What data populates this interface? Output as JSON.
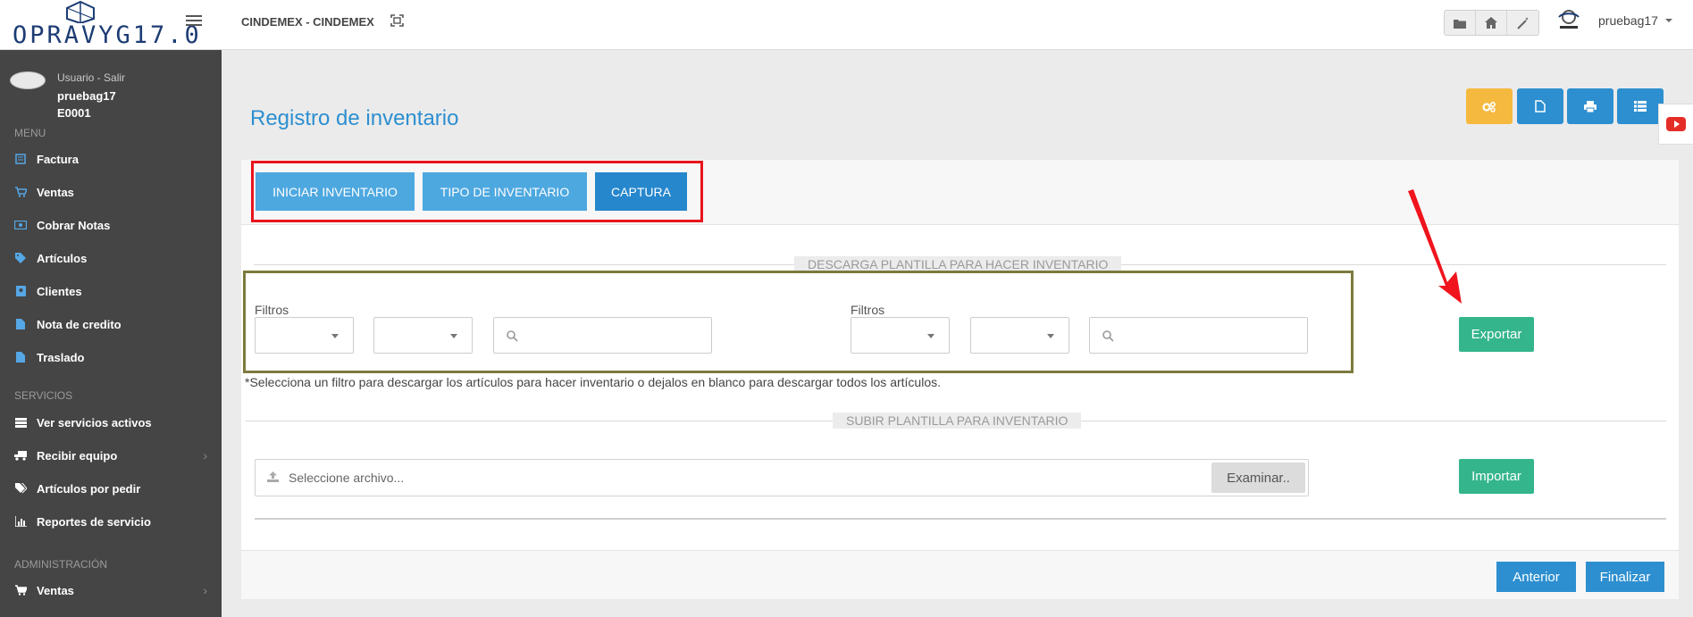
{
  "header": {
    "logo_text": "OPRAVYG17.0",
    "company": "CINDEMEX - CINDEMEX",
    "username": "pruebag17",
    "icons": [
      "folder-icon",
      "home-icon",
      "magic-wand-icon"
    ]
  },
  "sidebar": {
    "user_links": "Usuario - Salir",
    "user_name": "pruebag17",
    "user_code": "E0001",
    "sections": [
      "MENU",
      "SERVICIOS",
      "ADMINISTRACIÓN"
    ],
    "menu": [
      {
        "label": "Factura",
        "icon": "invoice-icon"
      },
      {
        "label": "Ventas",
        "icon": "cart-icon"
      },
      {
        "label": "Cobrar Notas",
        "icon": "money-icon"
      },
      {
        "label": "Artículos",
        "icon": "tag-icon"
      },
      {
        "label": "Clientes",
        "icon": "address-book-icon"
      },
      {
        "label": "Nota de credito",
        "icon": "document-icon"
      },
      {
        "label": "Traslado",
        "icon": "document-icon"
      }
    ],
    "servicios": [
      {
        "label": "Ver servicios activos",
        "icon": "server-icon"
      },
      {
        "label": "Recibir equipo",
        "icon": "truck-icon"
      },
      {
        "label": "Artículos por pedir",
        "icon": "tags-icon"
      },
      {
        "label": "Reportes de servicio",
        "icon": "bar-chart-icon"
      }
    ],
    "administracion": [
      {
        "label": "Ventas",
        "icon": "cart-icon"
      }
    ]
  },
  "main": {
    "title": "Registro de inventario",
    "toolbar_icons": [
      "cogs-icon",
      "file-icon",
      "print-icon",
      "list-icon"
    ],
    "steps": [
      "INICIAR INVENTARIO",
      "TIPO DE INVENTARIO",
      "CAPTURA"
    ],
    "download_legend": "DESCARGA PLANTILLA PARA HACER INVENTARIO",
    "filter_label": "Filtros",
    "note": "*Selecciona un filtro para descargar los artículos para hacer inventario o dejalos en blanco para descargar todos los artículos.",
    "export_label": "Exportar",
    "upload_legend": "SUBIR PLANTILLA PARA INVENTARIO",
    "file_placeholder": "Seleccione archivo...",
    "browse_label": "Examinar..",
    "import_label": "Importar",
    "prev_label": "Anterior",
    "finish_label": "Finalizar"
  },
  "colors": {
    "primary": "#2d8fd0",
    "step_light": "#4ea8e0",
    "step_active": "#2687cd",
    "success": "#34b58c",
    "warning": "#f5b93f",
    "sidebar": "#454545",
    "highlight_red": "#e8141c",
    "highlight_olive": "#7c7a3e"
  }
}
